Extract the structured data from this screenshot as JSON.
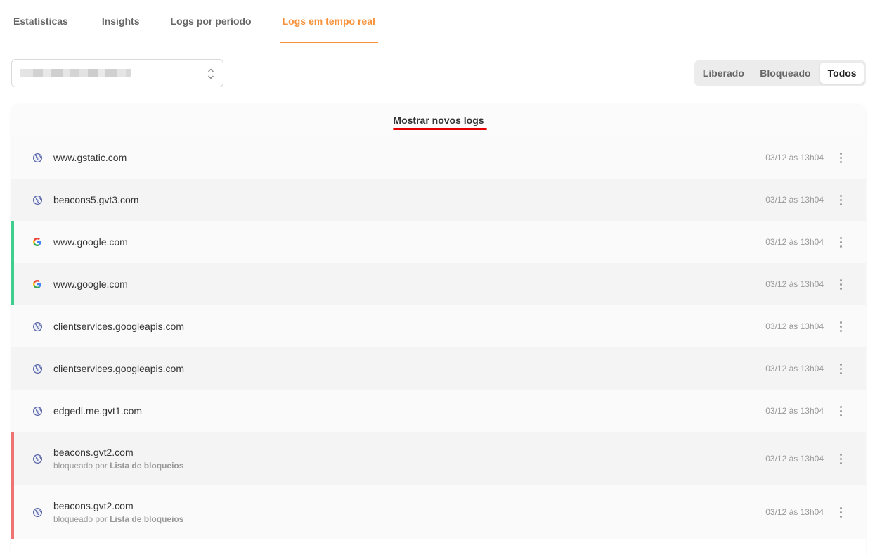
{
  "tabs": [
    {
      "label": "Estatísticas"
    },
    {
      "label": "Insights"
    },
    {
      "label": "Logs por período"
    },
    {
      "label": "Logs em tempo real",
      "active": true
    }
  ],
  "accent_color": "#f7923a",
  "filter": {
    "options": [
      "Liberado",
      "Bloqueado",
      "Todos"
    ],
    "selected": "Todos"
  },
  "logs": {
    "show_new_label": "Mostrar novos logs",
    "rows": [
      {
        "domain": "www.gstatic.com",
        "icon": "globe-icon",
        "time": "03/12 às 13h04",
        "status": "none"
      },
      {
        "domain": "beacons5.gvt3.com",
        "icon": "globe-icon",
        "time": "03/12 às 13h04",
        "status": "none"
      },
      {
        "domain": "www.google.com",
        "icon": "google-icon",
        "time": "03/12 às 13h04",
        "status": "allowed"
      },
      {
        "domain": "www.google.com",
        "icon": "google-icon",
        "time": "03/12 às 13h04",
        "status": "allowed"
      },
      {
        "domain": "clientservices.googleapis.com",
        "icon": "globe-icon",
        "time": "03/12 às 13h04",
        "status": "none"
      },
      {
        "domain": "clientservices.googleapis.com",
        "icon": "globe-icon",
        "time": "03/12 às 13h04",
        "status": "none"
      },
      {
        "domain": "edgedl.me.gvt1.com",
        "icon": "globe-icon",
        "time": "03/12 às 13h04",
        "status": "none"
      },
      {
        "domain": "beacons.gvt2.com",
        "icon": "globe-icon",
        "time": "03/12 às 13h04",
        "status": "blocked",
        "sub_prefix": "bloqueado por",
        "sub_source": "Lista de bloqueios"
      },
      {
        "domain": "beacons.gvt2.com",
        "icon": "globe-icon",
        "time": "03/12 às 13h04",
        "status": "blocked",
        "sub_prefix": "bloqueado por",
        "sub_source": "Lista de bloqueios"
      }
    ]
  },
  "status_colors": {
    "allowed": "#3ecf8e",
    "blocked": "#f07373",
    "highlight": "#e50000"
  }
}
